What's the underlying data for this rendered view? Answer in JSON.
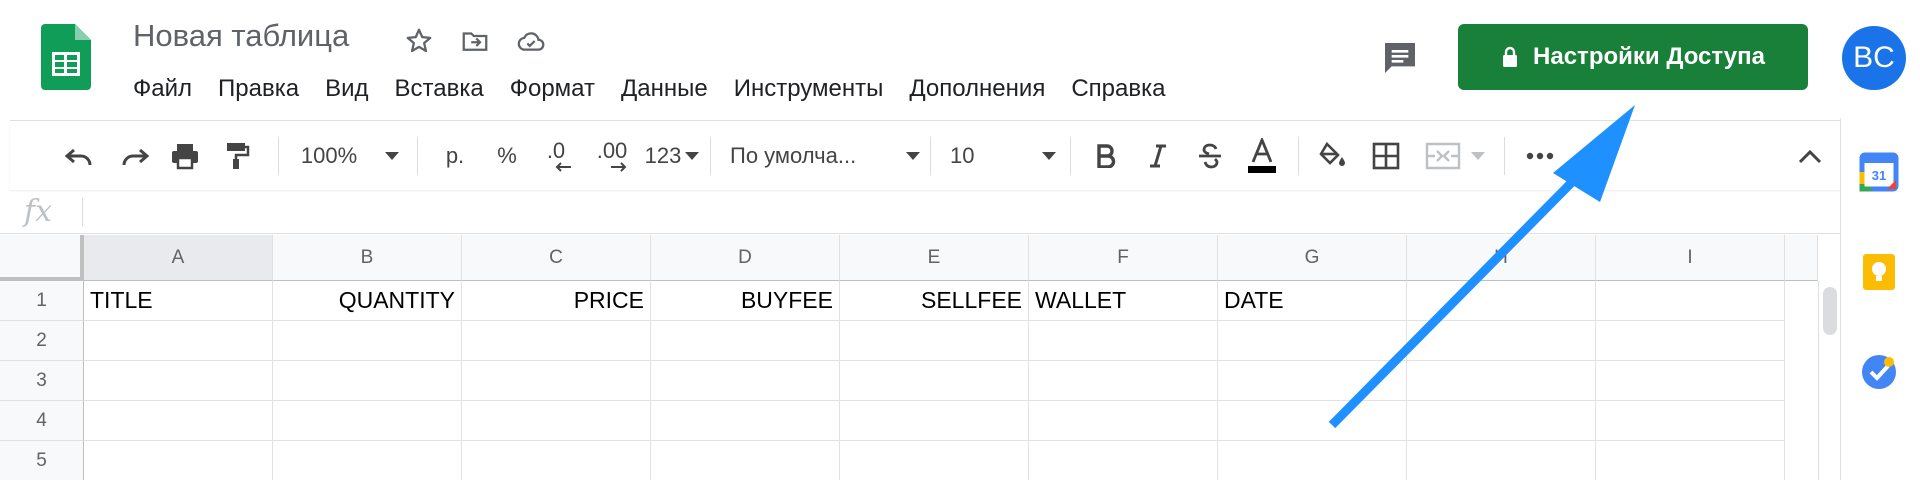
{
  "app": {
    "doc_title": "Новая таблица",
    "icons": [
      "sheets-logo-icon",
      "star-icon",
      "move-to-folder-icon",
      "cloud-saved-icon"
    ]
  },
  "menu": [
    "Файл",
    "Правка",
    "Вид",
    "Вставка",
    "Формат",
    "Данные",
    "Инструменты",
    "Дополнения",
    "Справка"
  ],
  "header_right": {
    "share_label": "Настройки Доступа",
    "avatar_initials": "BC",
    "share_color": "#188038",
    "avatar_color": "#1a73e8"
  },
  "toolbar": {
    "zoom": "100%",
    "currency": "р.",
    "percent": "%",
    "decrease_decimals": ".0",
    "increase_decimals": ".00",
    "more_formats": "123",
    "font": "По умолча...",
    "font_size": "10"
  },
  "formula_bar": {
    "fx": "fx"
  },
  "columns": [
    "A",
    "B",
    "C",
    "D",
    "E",
    "F",
    "G",
    "H",
    "I"
  ],
  "rows": [
    "1",
    "2",
    "3",
    "4",
    "5"
  ],
  "cells": {
    "row1": [
      "TITLE",
      "QUANTITY",
      "PRICE",
      "BUYFEE",
      "SELLFEE",
      "WALLET",
      "DATE",
      "",
      ""
    ]
  },
  "annotation": {
    "arrow_color": "#1e90ff"
  }
}
